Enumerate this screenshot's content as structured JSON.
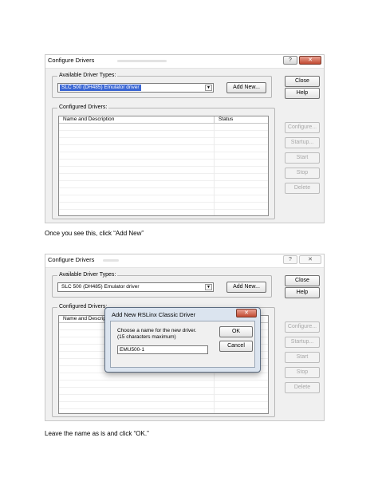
{
  "window": {
    "title": "Configure Drivers",
    "help_glyph": "?",
    "close_glyph": "✕"
  },
  "available": {
    "label": "Available Driver Types:",
    "selected": "SLC 500 (DH485) Emulator driver",
    "dropdown_glyph": "▼",
    "add_new_label": "Add New..."
  },
  "configured": {
    "label": "Configured Drivers:",
    "col_name": "Name and Description",
    "col_status": "Status"
  },
  "buttons": {
    "close": "Close",
    "help": "Help",
    "configure": "Configure...",
    "startup": "Startup...",
    "start": "Start",
    "stop": "Stop",
    "delete": "Delete"
  },
  "instructions": {
    "step1": "Once you see this, click “Add New”",
    "step2": "Leave the name as is and click “OK.”"
  },
  "add_dialog": {
    "title": "Add New RSLinx Classic Driver",
    "close_glyph": "✕",
    "prompt_line1": "Choose a name for the new driver.",
    "prompt_line2": "(15 characters maximum)",
    "name_value": "EMU500-1",
    "ok_label": "OK",
    "cancel_label": "Cancel"
  }
}
